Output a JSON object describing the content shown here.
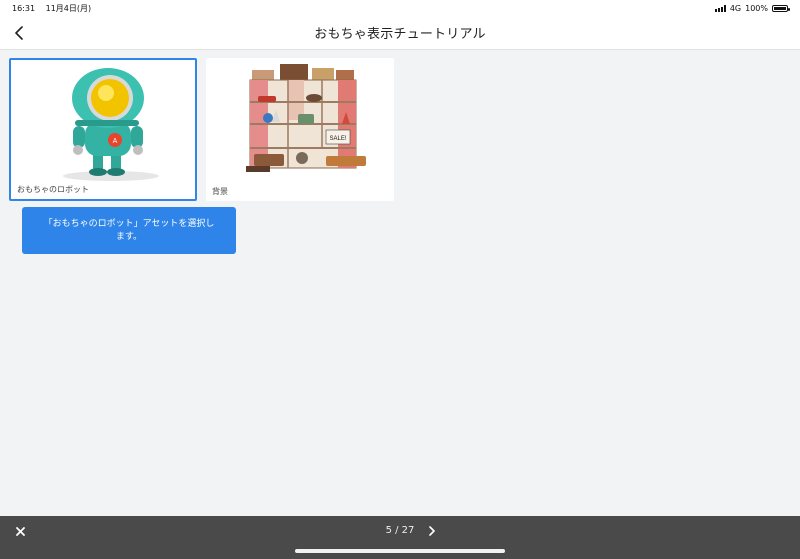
{
  "status_bar": {
    "time": "16:31",
    "date": "11月4日(月)",
    "network": "4G",
    "battery": "100%"
  },
  "nav": {
    "title": "おもちゃ表示チュートリアル",
    "back_icon": "chevron-left-icon"
  },
  "assets": [
    {
      "label": "おもちゃのロボット",
      "selected": true
    },
    {
      "label": "背景",
      "selected": false
    }
  ],
  "tooltip": {
    "text": "「おもちゃのロボット」アセットを選択します。"
  },
  "footer": {
    "close_icon": "close-icon",
    "page_counter": "5 / 27",
    "next_icon": "chevron-right-icon"
  },
  "colors": {
    "accent": "#2f86e8",
    "footer_bg": "#4a4a4a"
  }
}
